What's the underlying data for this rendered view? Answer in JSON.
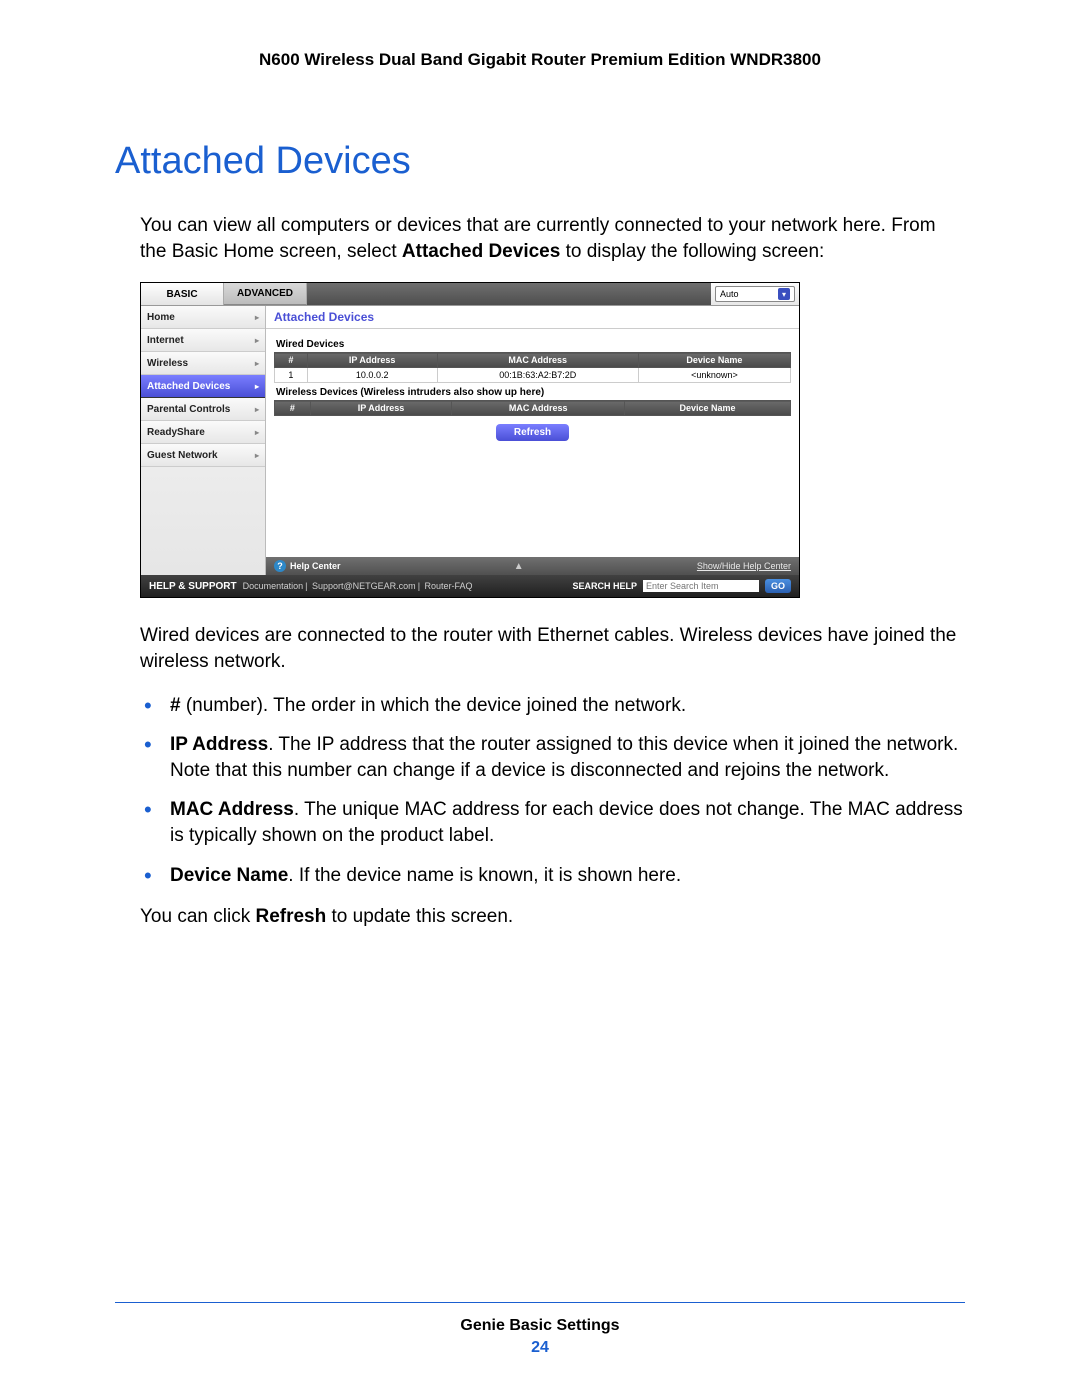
{
  "doc_header": "N600 Wireless Dual Band Gigabit Router Premium Edition WNDR3800",
  "page_title": "Attached Devices",
  "intro_html": "You can view all computers or devices that are currently connected to your network here. From the Basic Home screen, select <b>Attached Devices</b> to display the following screen:",
  "after_ss_html": "Wired devices are connected to the router with Ethernet cables. Wireless devices have joined the wireless network.",
  "bullets": [
    "<b>#</b> (number). The order in which the device joined the network.",
    "<b>IP Address</b>. The IP address that the router assigned to this device when it joined the network. Note that this number can change if a device is disconnected and rejoins the network.",
    "<b>MAC Address</b>. The unique MAC address for each device does not change. The MAC address is typically shown on the product label.",
    "<b>Device Name</b>. If the device name is known, it is shown here."
  ],
  "closing_html": "You can click <b>Refresh</b> to update this screen.",
  "footer": {
    "section": "Genie Basic Settings",
    "page": "24"
  },
  "ss": {
    "tabs": {
      "basic": "BASIC",
      "advanced": "ADVANCED"
    },
    "lang": "Auto",
    "sidebar": [
      {
        "label": "Home",
        "active": false
      },
      {
        "label": "Internet",
        "active": false
      },
      {
        "label": "Wireless",
        "active": false
      },
      {
        "label": "Attached Devices",
        "active": true
      },
      {
        "label": "Parental Controls",
        "active": false
      },
      {
        "label": "ReadyShare",
        "active": false
      },
      {
        "label": "Guest Network",
        "active": false
      }
    ],
    "main_title": "Attached Devices",
    "wired": {
      "label": "Wired Devices",
      "cols": [
        "#",
        "IP Address",
        "MAC Address",
        "Device Name"
      ],
      "rows": [
        {
          "num": "1",
          "ip": "10.0.0.2",
          "mac": "00:1B:63:A2:B7:2D",
          "name": "<unknown>"
        }
      ]
    },
    "wireless": {
      "label": "Wireless Devices (Wireless intruders also show up here)",
      "cols": [
        "#",
        "IP Address",
        "MAC Address",
        "Device Name"
      ]
    },
    "refresh": "Refresh",
    "help_center": "Help Center",
    "help_toggle": "Show/Hide Help Center",
    "footer_bar": {
      "title": "HELP & SUPPORT",
      "links": [
        "Documentation",
        "Support@NETGEAR.com",
        "Router-FAQ"
      ],
      "search_label": "SEARCH HELP",
      "search_placeholder": "Enter Search Item",
      "go": "GO"
    }
  }
}
